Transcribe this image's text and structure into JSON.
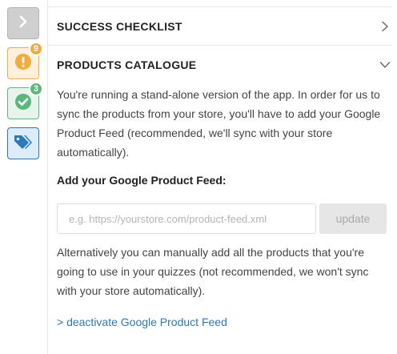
{
  "sidebar": {
    "items": [
      {
        "name": "collapse",
        "icon": "chevron-right-icon"
      },
      {
        "name": "warnings",
        "icon": "exclamation-circle-icon",
        "badge": "9",
        "color": "#f0ad3c"
      },
      {
        "name": "completed",
        "icon": "check-circle-icon",
        "badge": "3",
        "color": "#5cb87a"
      },
      {
        "name": "products",
        "icon": "tags-icon",
        "color": "#2b79b8"
      }
    ]
  },
  "sections": {
    "success_checklist": {
      "title": "SUCCESS CHECKLIST",
      "state": "collapsed"
    },
    "products_catalogue": {
      "title": "PRODUCTS CATALOGUE",
      "state": "expanded"
    }
  },
  "catalogue": {
    "intro": "You're running a stand-alone version of the app. In order for us to sync the products from your store, you'll have to add your Google Product Feed (recommended, we'll sync with your store automatically).",
    "feed_label": "Add your Google Product Feed:",
    "feed_input": {
      "value": "",
      "placeholder": "e.g. https://yourstore.com/product-feed.xml"
    },
    "update_label": "update",
    "alternative": "Alternatively you can manually add all the products that you're going to use in your quizzes (not recommended, we won't sync with your store automatically).",
    "deactivate_link": "> deactivate Google Product Feed"
  },
  "colors": {
    "link": "#2b79b8",
    "warning": "#f0ad3c",
    "success": "#5cb87a"
  }
}
